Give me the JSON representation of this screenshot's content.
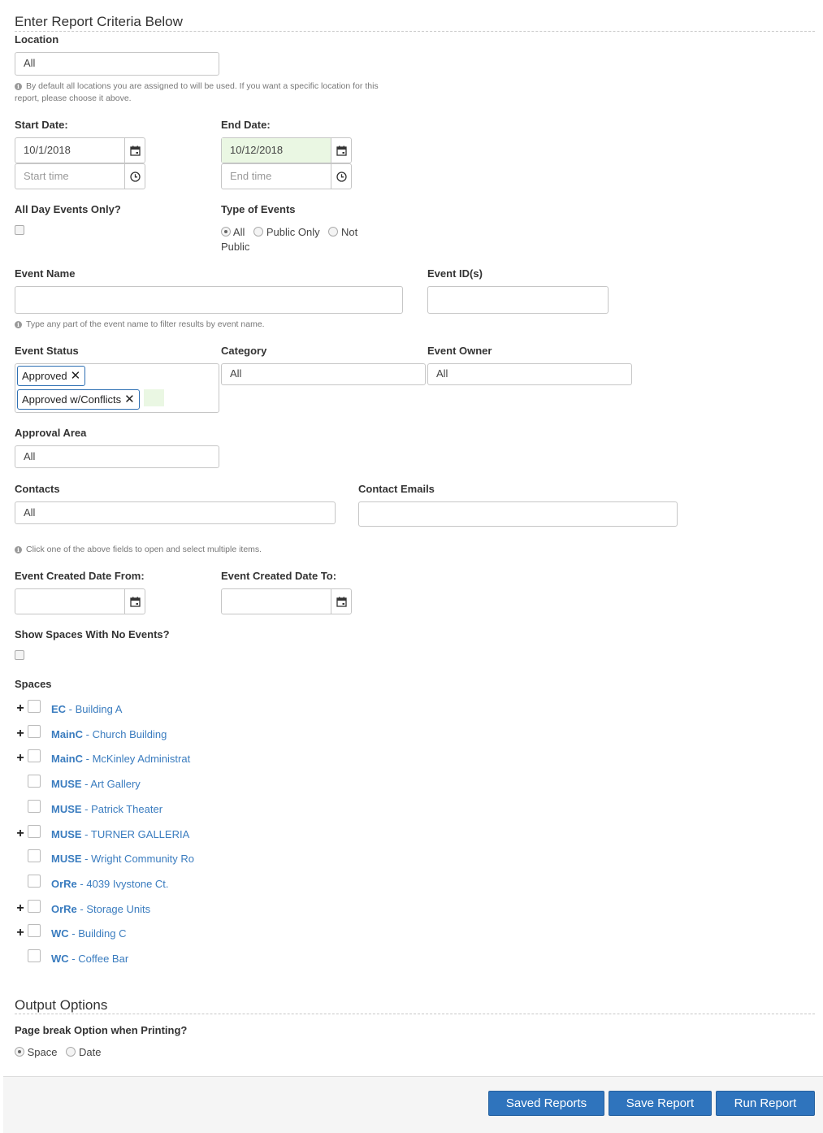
{
  "criteria": {
    "title": "Enter Report Criteria Below",
    "location": {
      "label": "Location",
      "value": "All",
      "help": "By default all locations you are assigned to will be used. If you want a specific location for this report, please choose it above."
    },
    "start_date": {
      "label": "Start Date:",
      "date": "10/1/2018",
      "time_placeholder": "Start time"
    },
    "end_date": {
      "label": "End Date:",
      "date": "10/12/2018",
      "time_placeholder": "End time"
    },
    "all_day": {
      "label": "All Day Events Only?"
    },
    "type_events": {
      "label": "Type of Events",
      "options": [
        "All",
        "Public Only",
        "Not Public"
      ],
      "selected": "All"
    },
    "event_name": {
      "label": "Event Name",
      "help": "Type any part of the event name to filter results by event name."
    },
    "event_ids": {
      "label": "Event ID(s)"
    },
    "event_status": {
      "label": "Event Status",
      "tags": [
        "Approved",
        "Approved w/Conflicts"
      ]
    },
    "category": {
      "label": "Category",
      "value": "All"
    },
    "event_owner": {
      "label": "Event Owner",
      "value": "All"
    },
    "approval_area": {
      "label": "Approval Area",
      "value": "All"
    },
    "contacts": {
      "label": "Contacts",
      "value": "All"
    },
    "contact_emails": {
      "label": "Contact Emails"
    },
    "multi_help": "Click one of the above fields to open and select multiple items.",
    "created_from": {
      "label": "Event Created Date From:"
    },
    "created_to": {
      "label": "Event Created Date To:"
    },
    "show_spaces": {
      "label": "Show Spaces With No Events?"
    },
    "spaces": {
      "label": "Spaces",
      "items": [
        {
          "code": "EC",
          "name": "Building A",
          "expandable": true
        },
        {
          "code": "MainC",
          "name": "Church Building",
          "expandable": true
        },
        {
          "code": "MainC",
          "name": "McKinley Administrat",
          "expandable": true
        },
        {
          "code": "MUSE",
          "name": "Art Gallery",
          "expandable": false
        },
        {
          "code": "MUSE",
          "name": "Patrick Theater",
          "expandable": false
        },
        {
          "code": "MUSE",
          "name": "TURNER GALLERIA",
          "expandable": true
        },
        {
          "code": "MUSE",
          "name": "Wright Community Ro",
          "expandable": false
        },
        {
          "code": "OrRe",
          "name": "4039 Ivystone Ct.",
          "expandable": false
        },
        {
          "code": "OrRe",
          "name": "Storage Units",
          "expandable": true
        },
        {
          "code": "WC",
          "name": "Building C",
          "expandable": true
        },
        {
          "code": "WC",
          "name": "Coffee Bar",
          "expandable": false
        }
      ]
    }
  },
  "output": {
    "title": "Output Options",
    "page_break": {
      "label": "Page break Option when Printing?",
      "options": [
        "Space",
        "Date"
      ],
      "selected": "Space"
    }
  },
  "footer": {
    "saved_reports": "Saved Reports",
    "save_report": "Save Report",
    "run_report": "Run Report"
  },
  "colors": {
    "primary_button": "#2f74bd",
    "link": "#3a7cbf",
    "highlight": "#eaf7e3"
  }
}
